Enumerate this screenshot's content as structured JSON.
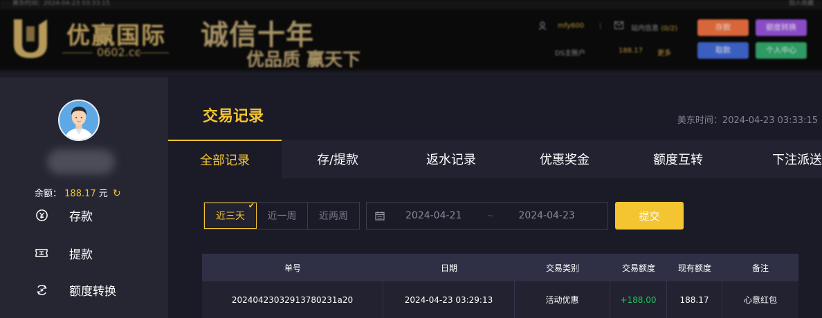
{
  "header": {
    "topbar_text": "美东时间：2024-04-23 03:33:15",
    "topbar_right": "加入收藏",
    "logo_text": "优赢国际",
    "logo_url": "0602.cc",
    "slogan_main": "诚信十年",
    "slogan_sub": "优品质 赢天下",
    "username": "mfy600",
    "messages_label": "站内信息",
    "messages_count": "(0/2)",
    "ds_account_label": "DS主账户",
    "ds_balance": "188.17",
    "more_label": "更多",
    "buttons": {
      "deposit": "存款",
      "transfer": "额度转换",
      "withdraw": "取款",
      "profile": "个人中心"
    }
  },
  "sidebar": {
    "balance_label": "余额：",
    "balance_value": "188.17",
    "balance_unit": "元",
    "items": [
      {
        "label": "存款"
      },
      {
        "label": "提款"
      },
      {
        "label": "额度转换"
      }
    ]
  },
  "main": {
    "title": "交易记录",
    "time_label": "美东时间：2024-04-23 03:33:15",
    "tabs": [
      {
        "label": "全部记录"
      },
      {
        "label": "存/提款"
      },
      {
        "label": "返水记录"
      },
      {
        "label": "优惠奖金"
      },
      {
        "label": "额度互转"
      },
      {
        "label": "下注派送"
      }
    ],
    "ranges": [
      {
        "label": "近三天"
      },
      {
        "label": "近一周"
      },
      {
        "label": "近两周"
      }
    ],
    "date_start": "2024-04-21",
    "date_sep": "~",
    "date_end": "2024-04-23",
    "submit_label": "提交",
    "table": {
      "headers": [
        "单号",
        "日期",
        "交易类别",
        "交易额度",
        "现有额度",
        "备注"
      ],
      "rows": [
        {
          "order_no": "20240423032913780231a20",
          "date": "2024-04-23 03:29:13",
          "type": "活动优惠",
          "amount": "+188.00",
          "current": "188.17",
          "note": "心意红包"
        }
      ]
    }
  },
  "colors": {
    "accent": "#f4c531",
    "positive": "#21c55d",
    "header_bg": "#0a0a0a",
    "sidebar_bg": "#262633",
    "main_bg": "#1b1b28"
  }
}
